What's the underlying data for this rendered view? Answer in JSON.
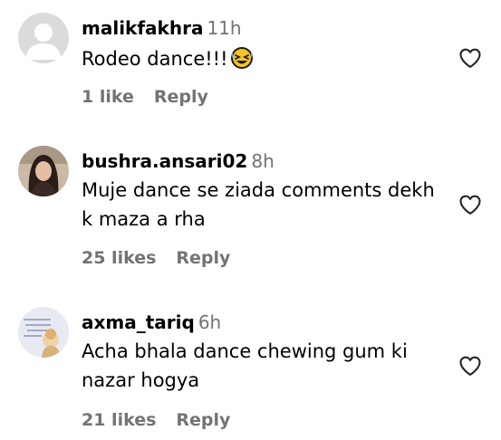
{
  "comments": [
    {
      "username": "malikfakhra",
      "time": "11h",
      "text": "Rodeo dance!!!",
      "emoji": "rolling-on-floor-laughing-emoji",
      "likes": "1 like",
      "reply": "Reply",
      "avatar": "default-avatar"
    },
    {
      "username": "bushra.ansari02",
      "time": "8h",
      "text": "Muje dance se ziada comments dekh k maza a rha",
      "likes": "25 likes",
      "reply": "Reply",
      "avatar": "profile-photo"
    },
    {
      "username": "axma_tariq",
      "time": "6h",
      "text": "Acha bhala dance chewing gum ki nazar hogya",
      "likes": "21 likes",
      "reply": "Reply",
      "avatar": "profile-photo"
    }
  ],
  "colors": {
    "secondary_text": "#737373",
    "primary_text": "#000000",
    "icon_outline": "#262626"
  }
}
